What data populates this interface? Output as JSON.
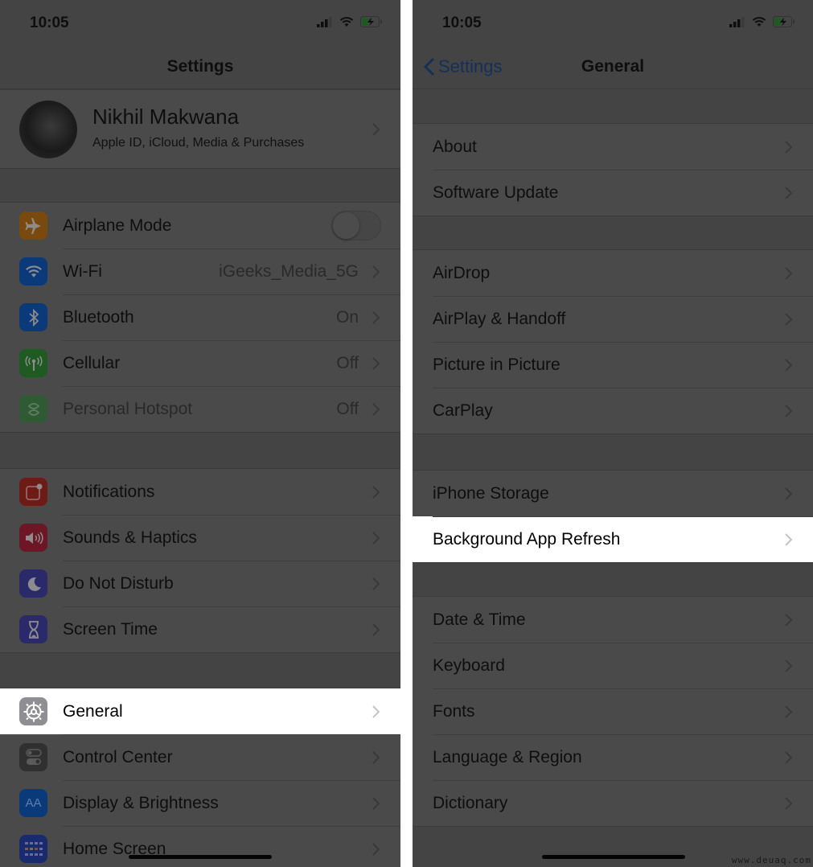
{
  "left": {
    "status": {
      "time": "10:05"
    },
    "nav": {
      "title": "Settings"
    },
    "profile": {
      "name": "Nikhil Makwana",
      "subtitle": "Apple ID, iCloud, Media & Purchases"
    },
    "group1": [
      {
        "label": "Airplane Mode",
        "icon": "airplane-icon",
        "color": "#7a4a0c",
        "toggle": false
      },
      {
        "label": "Wi-Fi",
        "icon": "wifi-icon",
        "color": "#0b3a7a",
        "value": "iGeeks_Media_5G"
      },
      {
        "label": "Bluetooth",
        "icon": "bluetooth-icon",
        "color": "#0b3a7a",
        "value": "On"
      },
      {
        "label": "Cellular",
        "icon": "antenna-icon",
        "color": "#1e5a22",
        "value": "Off"
      },
      {
        "label": "Personal Hotspot",
        "icon": "hotspot-icon",
        "color": "#2f5a33",
        "value": "Off",
        "disabled": true
      }
    ],
    "group2": [
      {
        "label": "Notifications",
        "icon": "notifications-icon",
        "color": "#6e1a15"
      },
      {
        "label": "Sounds & Haptics",
        "icon": "speaker-icon",
        "color": "#6e1526"
      },
      {
        "label": "Do Not Disturb",
        "icon": "moon-icon",
        "color": "#2a2a6a"
      },
      {
        "label": "Screen Time",
        "icon": "hourglass-icon",
        "color": "#2a2a6a"
      }
    ],
    "group3": [
      {
        "label": "General",
        "icon": "gear-icon",
        "color": "#8e8e93",
        "highlighted": true
      },
      {
        "label": "Control Center",
        "icon": "switches-icon",
        "color": "#303030"
      },
      {
        "label": "Display & Brightness",
        "icon": "text-size-icon",
        "color": "#0b3a7a",
        "glyph": "AA"
      },
      {
        "label": "Home Screen",
        "icon": "grid-icon",
        "color": "#1a2a6e"
      }
    ]
  },
  "right": {
    "status": {
      "time": "10:05"
    },
    "nav": {
      "title": "General",
      "back_label": "Settings"
    },
    "group1": [
      {
        "label": "About"
      },
      {
        "label": "Software Update"
      }
    ],
    "group2": [
      {
        "label": "AirDrop"
      },
      {
        "label": "AirPlay & Handoff"
      },
      {
        "label": "Picture in Picture"
      },
      {
        "label": "CarPlay"
      }
    ],
    "group3": [
      {
        "label": "iPhone Storage"
      },
      {
        "label": "Background App Refresh",
        "highlighted": true
      }
    ],
    "group4": [
      {
        "label": "Date & Time"
      },
      {
        "label": "Keyboard"
      },
      {
        "label": "Fonts"
      },
      {
        "label": "Language & Region"
      },
      {
        "label": "Dictionary"
      }
    ]
  },
  "watermark": "www.deuaq.com"
}
